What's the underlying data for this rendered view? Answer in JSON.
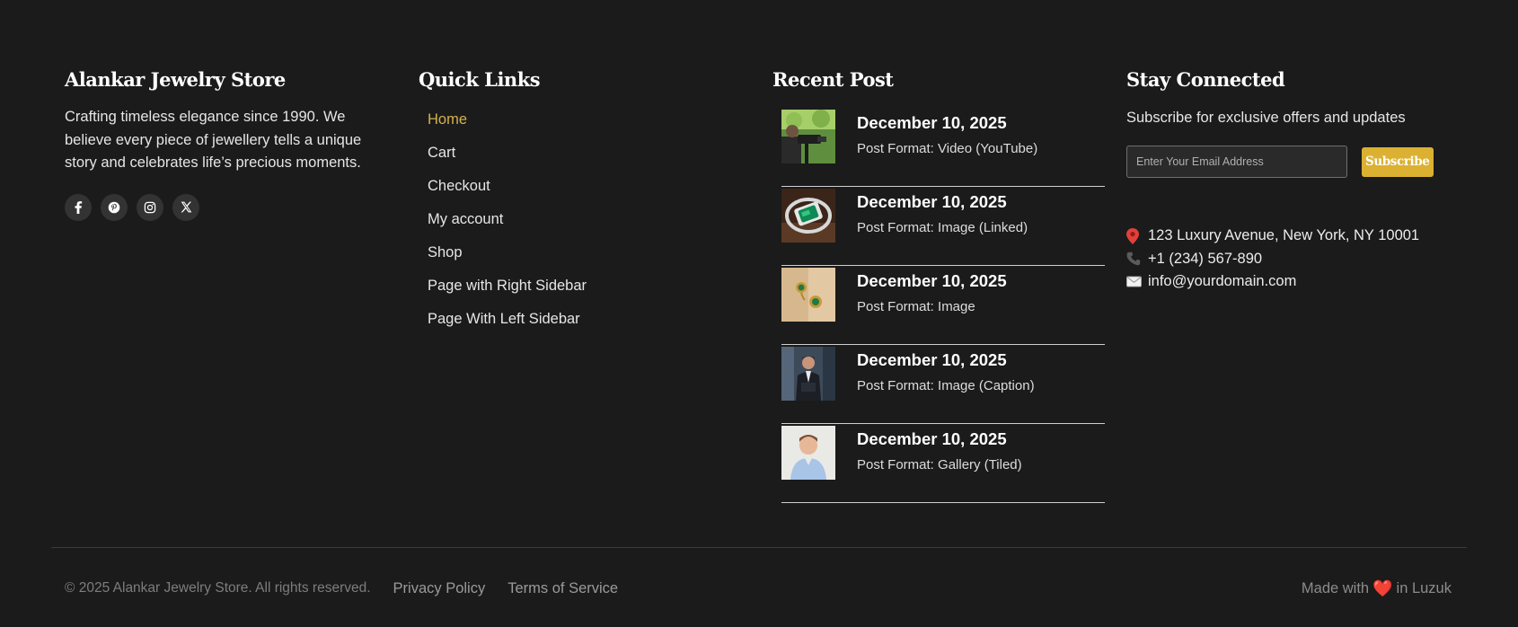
{
  "about": {
    "title": "Alankar Jewelry Store",
    "text": "Crafting timeless elegance since 1990. We believe every piece of jewellery tells a unique story and celebrates life’s precious moments.",
    "socials": [
      "facebook-icon",
      "pinterest-icon",
      "instagram-icon",
      "x-icon"
    ]
  },
  "quick_links": {
    "title": "Quick Links",
    "items": [
      {
        "label": "Home",
        "active": true
      },
      {
        "label": "Cart"
      },
      {
        "label": "Checkout"
      },
      {
        "label": "My account"
      },
      {
        "label": "Shop"
      },
      {
        "label": "Page with Right Sidebar"
      },
      {
        "label": "Page With Left Sidebar"
      }
    ]
  },
  "recent_posts": {
    "title": "Recent Post",
    "items": [
      {
        "date": "December 10, 2025",
        "format": "Post Format: Video (YouTube)"
      },
      {
        "date": "December 10, 2025",
        "format": "Post Format: Image (Linked)"
      },
      {
        "date": "December 10, 2025",
        "format": "Post Format: Image"
      },
      {
        "date": "December 10, 2025",
        "format": "Post Format: Image (Caption)"
      },
      {
        "date": "December 10, 2025",
        "format": "Post Format: Gallery (Tiled)"
      }
    ]
  },
  "connect": {
    "title": "Stay Connected",
    "subtitle": "Subscribe for exclusive offers and updates",
    "email_placeholder": "Enter Your Email Address",
    "subscribe_label": "Subscribe",
    "address": "123 Luxury Avenue, New York, NY 10001",
    "phone": "+1 (234) 567-890",
    "email": "info@yourdomain.com"
  },
  "bottom": {
    "copyright": "© 2025 Alankar Jewelry Store. All rights reserved.",
    "privacy": "Privacy Policy",
    "terms": "Terms of Service",
    "made_pre": "Made with",
    "heart": "❤️",
    "made_post": "in Luzuk"
  },
  "colors": {
    "background": "#1b1b1b",
    "accent": "#dcb132",
    "active_link": "#d4b14a"
  }
}
